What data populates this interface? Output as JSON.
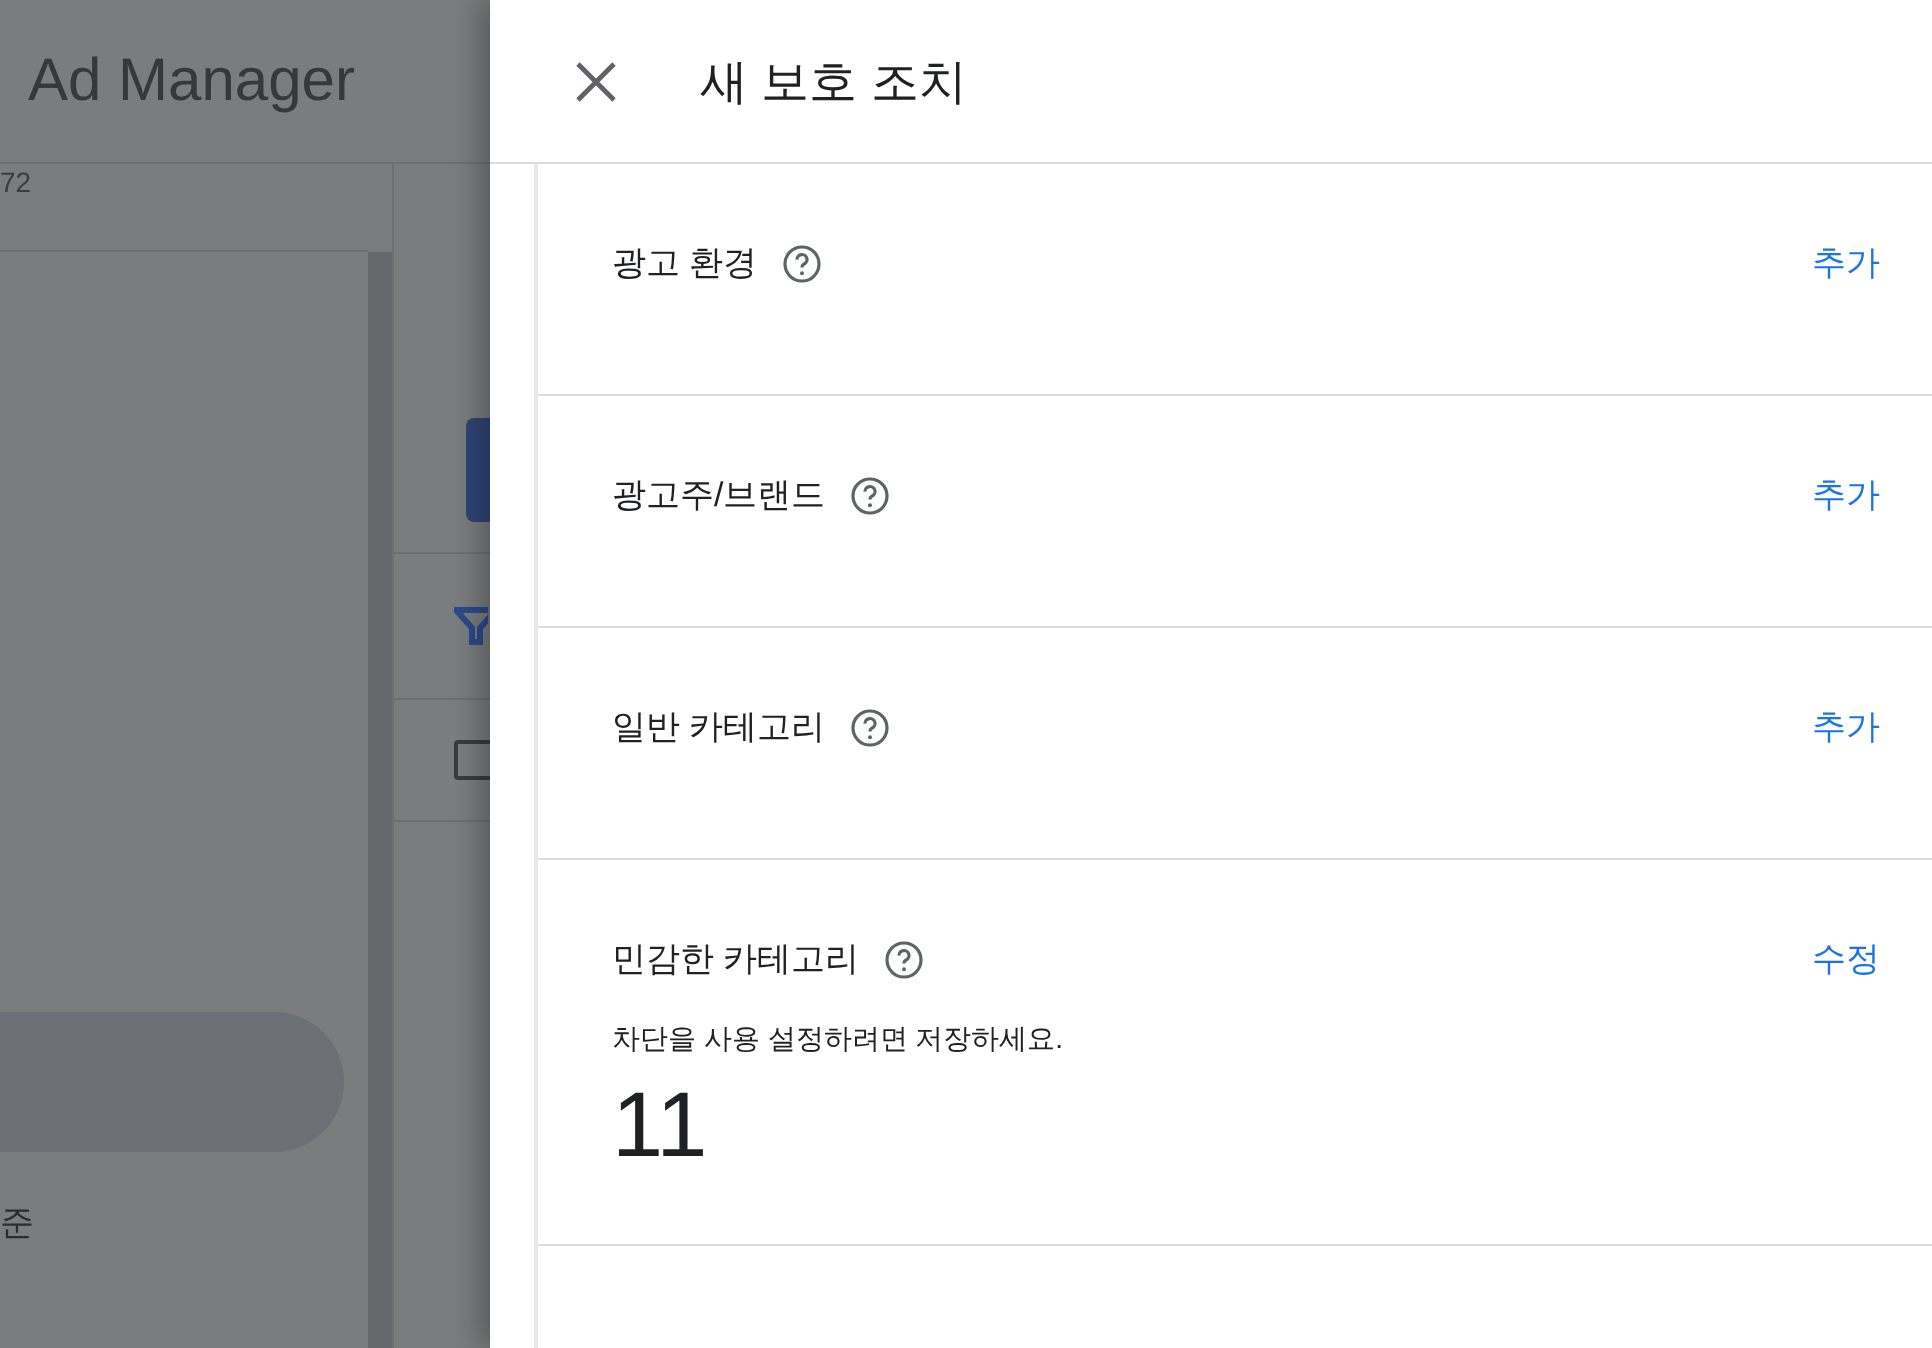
{
  "backdrop": {
    "app_title": "Ad Manager",
    "id_fragment": "72",
    "text_fragment": "준",
    "checkbox": {
      "checked": false
    }
  },
  "panel": {
    "title": "새 보호 조치",
    "sections": [
      {
        "label": "광고 환경",
        "action": "추가"
      },
      {
        "label": "광고주/브랜드",
        "action": "추가"
      },
      {
        "label": "일반 카테고리",
        "action": "추가"
      },
      {
        "label": "민감한 카테고리",
        "action": "수정",
        "note": "차단을 사용 설정하려면 저장하세요.",
        "count": "11"
      }
    ]
  }
}
